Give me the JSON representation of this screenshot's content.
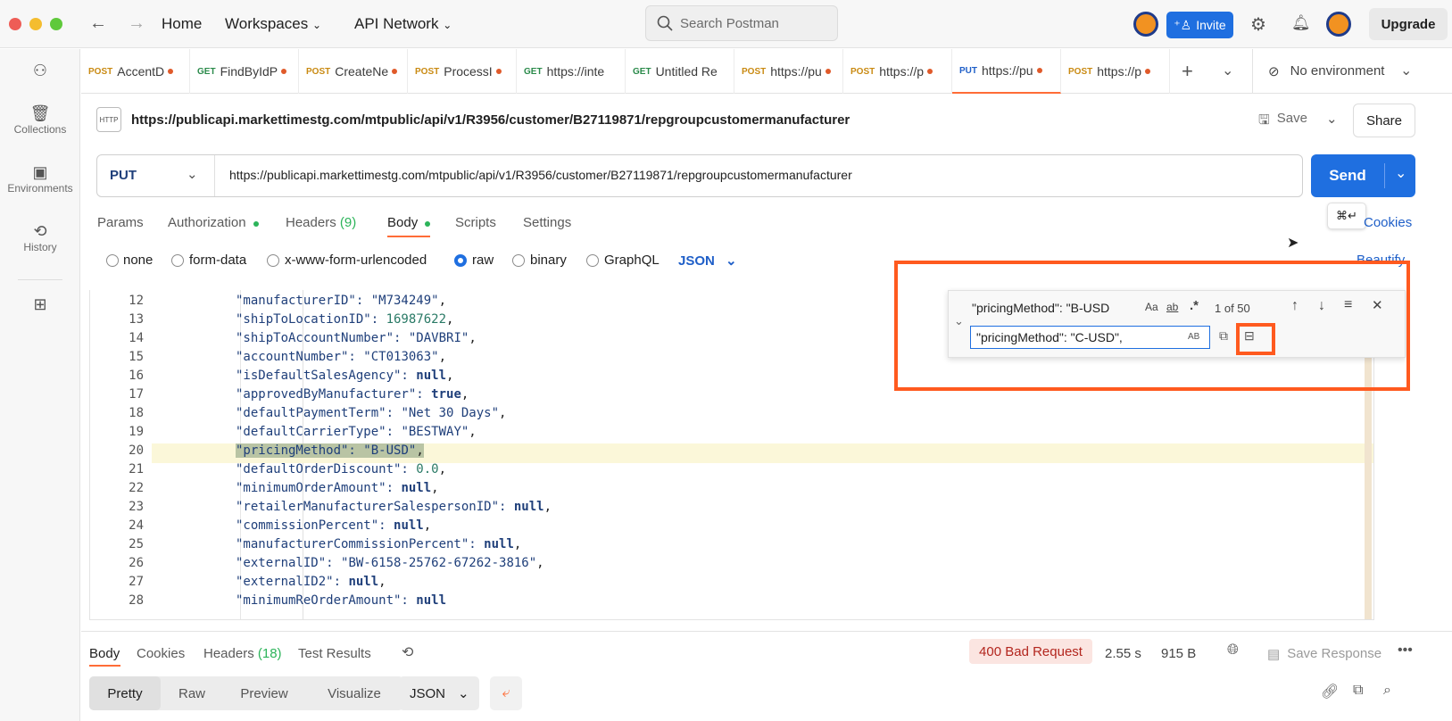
{
  "nav": {
    "home": "Home",
    "workspaces": "Workspaces",
    "api_network": "API Network",
    "search_placeholder": "Search Postman",
    "invite": "Invite",
    "upgrade": "Upgrade"
  },
  "sidebar": {
    "items": [
      {
        "label": "Collections",
        "icon": "collections-icon"
      },
      {
        "label": "Environments",
        "icon": "environments-icon"
      },
      {
        "label": "History",
        "icon": "history-icon"
      }
    ]
  },
  "tabs": [
    {
      "method": "POST",
      "name": "AccentD"
    },
    {
      "method": "GET",
      "name": "FindByIdP"
    },
    {
      "method": "POST",
      "name": "CreateNe"
    },
    {
      "method": "POST",
      "name": "ProcessI"
    },
    {
      "method": "GET",
      "name": "https://inte"
    },
    {
      "method": "GET",
      "name": "Untitled Re"
    },
    {
      "method": "POST",
      "name": "https://pu"
    },
    {
      "method": "POST",
      "name": "https://p"
    },
    {
      "method": "PUT",
      "name": "https://pu"
    },
    {
      "method": "POST",
      "name": "https://p"
    }
  ],
  "environment": "No environment",
  "request": {
    "title": "https://publicapi.markettimestg.com/mtpublic/api/v1/R3956/customer/B27119871/repgroupcustomermanufacturer",
    "method": "PUT",
    "url": "https://publicapi.markettimestg.com/mtpublic/api/v1/R3956/customer/B27119871/repgroupcustomermanufacturer",
    "save": "Save",
    "share": "Share",
    "send": "Send",
    "shortcut": "⌘↵",
    "cookies": "Cookies",
    "beautify": "Beautify"
  },
  "req_tabs": {
    "params": "Params",
    "authorization": "Authorization",
    "headers": "Headers",
    "headers_count": "(9)",
    "body": "Body",
    "scripts": "Scripts",
    "settings": "Settings"
  },
  "body_modes": {
    "none": "none",
    "form_data": "form-data",
    "urlencoded": "x-www-form-urlencoded",
    "raw": "raw",
    "binary": "binary",
    "graphql": "GraphQL",
    "format": "JSON"
  },
  "find": {
    "query": "\"pricingMethod\": \"B-USD",
    "count": "1 of 50",
    "replace": "\"pricingMethod\": \"C-USD\",",
    "aa": "Aa",
    "ab": "ab",
    "regex": ".*",
    "preserve": "AB"
  },
  "code": [
    {
      "n": "12",
      "key": "manufacturerID",
      "val": "\"M734249\"",
      "t": "s",
      "comma": true
    },
    {
      "n": "13",
      "key": "shipToLocationID",
      "val": "16987622",
      "t": "n",
      "comma": true
    },
    {
      "n": "14",
      "key": "shipToAccountNumber",
      "val": "\"DAVBRI\"",
      "t": "s",
      "comma": true
    },
    {
      "n": "15",
      "key": "accountNumber",
      "val": "\"CT013063\"",
      "t": "s",
      "comma": true
    },
    {
      "n": "16",
      "key": "isDefaultSalesAgency",
      "val": "null",
      "t": "kw",
      "comma": true
    },
    {
      "n": "17",
      "key": "approvedByManufacturer",
      "val": "true",
      "t": "kw",
      "comma": true
    },
    {
      "n": "18",
      "key": "defaultPaymentTerm",
      "val": "\"Net 30 Days\"",
      "t": "s",
      "comma": true
    },
    {
      "n": "19",
      "key": "defaultCarrierType",
      "val": "\"BESTWAY\"",
      "t": "s",
      "comma": true
    },
    {
      "n": "20",
      "key": "pricingMethod",
      "val": "\"B-USD\"",
      "t": "s",
      "comma": true
    },
    {
      "n": "21",
      "key": "defaultOrderDiscount",
      "val": "0.0",
      "t": "n",
      "comma": true
    },
    {
      "n": "22",
      "key": "minimumOrderAmount",
      "val": "null",
      "t": "kw",
      "comma": true
    },
    {
      "n": "23",
      "key": "retailerManufacturerSalespersonID",
      "val": "null",
      "t": "kw",
      "comma": true
    },
    {
      "n": "24",
      "key": "commissionPercent",
      "val": "null",
      "t": "kw",
      "comma": true
    },
    {
      "n": "25",
      "key": "manufacturerCommissionPercent",
      "val": "null",
      "t": "kw",
      "comma": true
    },
    {
      "n": "26",
      "key": "externalID",
      "val": "\"BW-6158-25762-67262-3816\"",
      "t": "s",
      "comma": true
    },
    {
      "n": "27",
      "key": "externalID2",
      "val": "null",
      "t": "kw",
      "comma": true
    },
    {
      "n": "28",
      "key": "minimumReOrderAmount",
      "val": "null",
      "t": "kw",
      "comma": false
    }
  ],
  "response": {
    "body": "Body",
    "cookies": "Cookies",
    "headers": "Headers",
    "headers_count": "(18)",
    "test_results": "Test Results",
    "status": "400 Bad Request",
    "time": "2.55 s",
    "size": "915 B",
    "save_response": "Save Response",
    "views": [
      "Pretty",
      "Raw",
      "Preview",
      "Visualize"
    ],
    "format": "JSON"
  },
  "colors": {
    "accent": "#1560d4",
    "orange": "#ff6c37",
    "highlight_box": "#ff5a1f"
  }
}
